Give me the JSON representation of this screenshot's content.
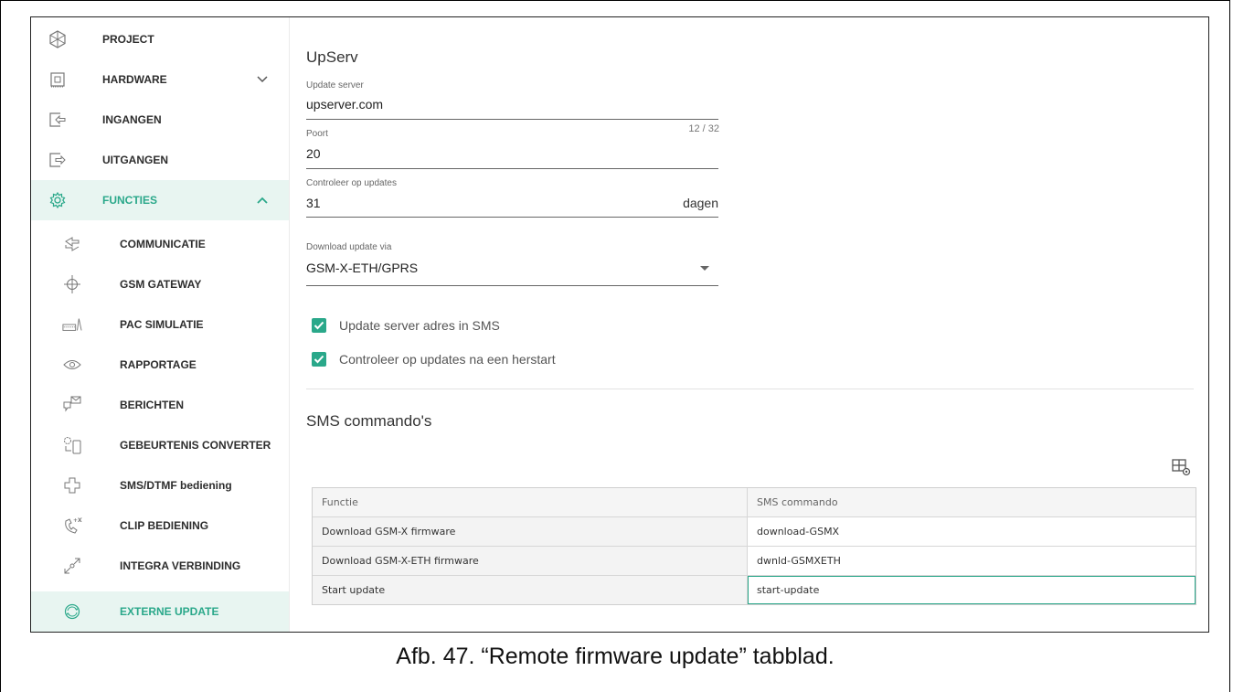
{
  "sidebar": {
    "items": [
      {
        "label": "PROJECT",
        "icon": "project-icon"
      },
      {
        "label": "HARDWARE",
        "icon": "hardware-icon"
      },
      {
        "label": "INGANGEN",
        "icon": "input-icon"
      },
      {
        "label": "UITGANGEN",
        "icon": "output-icon"
      },
      {
        "label": "FUNCTIES",
        "icon": "gear-icon"
      },
      {
        "label": "COMMUNICATIE",
        "icon": "communication-icon"
      },
      {
        "label": "GSM GATEWAY",
        "icon": "gsm-gateway-icon"
      },
      {
        "label": "PAC SIMULATIE",
        "icon": "pac-simulation-icon"
      },
      {
        "label": "RAPPORTAGE",
        "icon": "eye-icon"
      },
      {
        "label": "BERICHTEN",
        "icon": "messages-icon"
      },
      {
        "label": "GEBEURTENIS CONVERTER",
        "icon": "event-converter-icon"
      },
      {
        "label": "SMS/DTMF bediening",
        "icon": "sms-dtmf-icon"
      },
      {
        "label": "CLIP BEDIENING",
        "icon": "clip-icon"
      },
      {
        "label": "INTEGRA VERBINDING",
        "icon": "integra-icon"
      },
      {
        "label": "EXTERNE UPDATE",
        "icon": "refresh-icon"
      }
    ],
    "accent": "#2aa88a"
  },
  "upserv": {
    "title": "UpServ",
    "update_server": {
      "label": "Update server",
      "value": "upserver.com",
      "counter": "12 / 32"
    },
    "port": {
      "label": "Poort",
      "value": "20"
    },
    "check": {
      "label": "Controleer op updates",
      "value": "31",
      "suffix": "dagen"
    },
    "download": {
      "label": "Download update via",
      "value": "GSM-X-ETH/GPRS"
    },
    "checkboxes": [
      {
        "label": "Update server adres in SMS",
        "checked": true
      },
      {
        "label": "Controleer op updates na een herstart",
        "checked": true
      }
    ]
  },
  "sms": {
    "title": "SMS commando's",
    "columns": [
      "Functie",
      "SMS commando"
    ],
    "rows": [
      [
        "Download GSM-X firmware",
        "download-GSMX"
      ],
      [
        "Download GSM-X-ETH firmware",
        "dwnld-GSMXETH"
      ],
      [
        "Start update",
        "start-update"
      ]
    ]
  },
  "caption": "Afb. 47. “Remote firmware update” tabblad."
}
